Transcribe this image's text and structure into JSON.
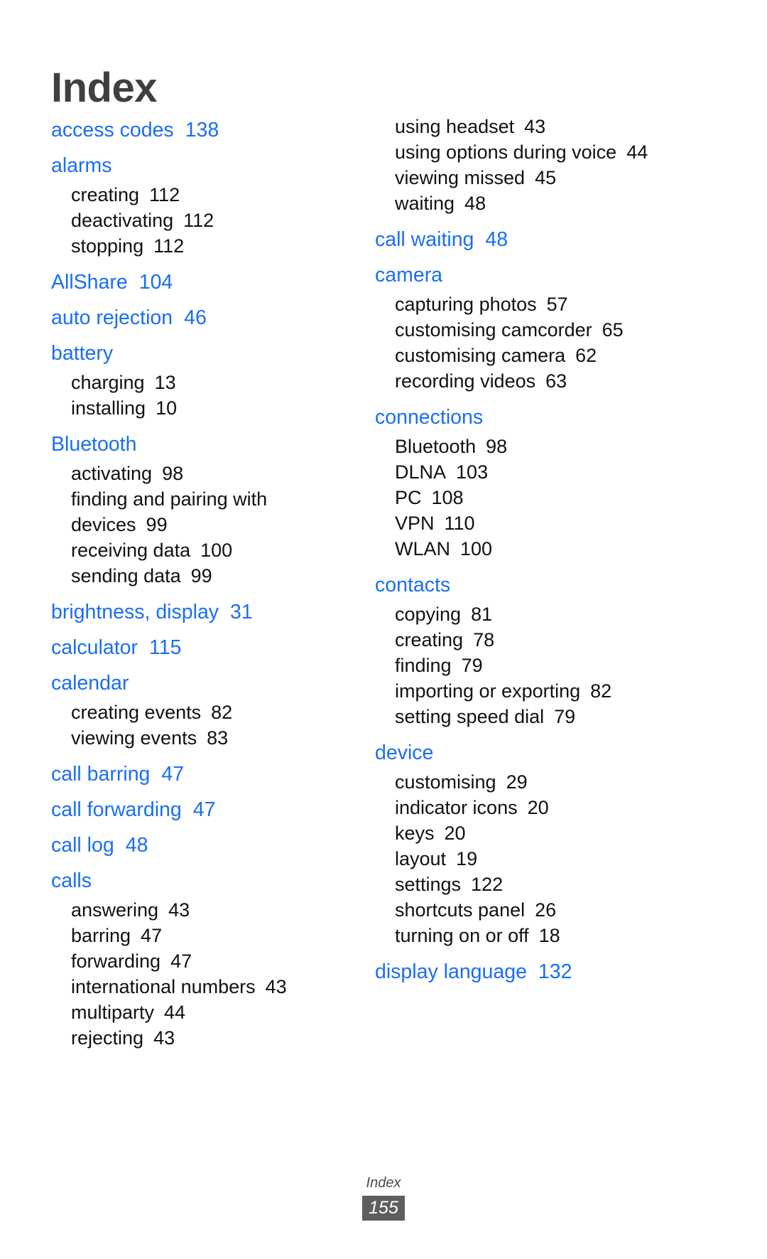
{
  "page": {
    "title": "Index",
    "footer_label": "Index",
    "footer_page_number": "155",
    "accent_color": "#1a6ef5",
    "title_color": "#3f3f3f",
    "body_color": "#111111",
    "footer_badge_bg": "#5e5e5e"
  },
  "columns": [
    {
      "id": "left",
      "entries": [
        {
          "heading": "access codes",
          "page": "138",
          "subs": []
        },
        {
          "heading": "alarms",
          "page": "",
          "subs": [
            {
              "label": "creating",
              "page": "112"
            },
            {
              "label": "deactivating",
              "page": "112"
            },
            {
              "label": "stopping",
              "page": "112"
            }
          ]
        },
        {
          "heading": "AllShare",
          "page": "104",
          "subs": []
        },
        {
          "heading": "auto rejection",
          "page": "46",
          "subs": []
        },
        {
          "heading": "battery",
          "page": "",
          "subs": [
            {
              "label": "charging",
              "page": "13"
            },
            {
              "label": "installing",
              "page": "10"
            }
          ]
        },
        {
          "heading": "Bluetooth",
          "page": "",
          "subs": [
            {
              "label": "activating",
              "page": "98"
            },
            {
              "label": "finding and pairing with devices",
              "page": "99"
            },
            {
              "label": "receiving data",
              "page": "100"
            },
            {
              "label": "sending data",
              "page": "99"
            }
          ]
        },
        {
          "heading": "brightness, display",
          "page": "31",
          "subs": []
        },
        {
          "heading": "calculator",
          "page": "115",
          "subs": []
        },
        {
          "heading": "calendar",
          "page": "",
          "subs": [
            {
              "label": "creating events",
              "page": "82"
            },
            {
              "label": "viewing events",
              "page": "83"
            }
          ]
        },
        {
          "heading": "call barring",
          "page": "47",
          "subs": []
        },
        {
          "heading": "call forwarding",
          "page": "47",
          "subs": []
        },
        {
          "heading": "call log",
          "page": "48",
          "subs": []
        },
        {
          "heading": "calls",
          "page": "",
          "subs": [
            {
              "label": "answering",
              "page": "43"
            },
            {
              "label": "barring",
              "page": "47"
            },
            {
              "label": "forwarding",
              "page": "47"
            },
            {
              "label": "international numbers",
              "page": "43"
            },
            {
              "label": "multiparty",
              "page": "44"
            },
            {
              "label": "rejecting",
              "page": "43"
            }
          ]
        }
      ]
    },
    {
      "id": "right",
      "entries": [
        {
          "heading": "",
          "page": "",
          "subs": [
            {
              "label": "using headset",
              "page": "43"
            },
            {
              "label": "using options during voice",
              "page": "44"
            },
            {
              "label": "viewing missed",
              "page": "45"
            },
            {
              "label": "waiting",
              "page": "48"
            }
          ]
        },
        {
          "heading": "call waiting",
          "page": "48",
          "subs": []
        },
        {
          "heading": "camera",
          "page": "",
          "subs": [
            {
              "label": "capturing photos",
              "page": "57"
            },
            {
              "label": "customising camcorder",
              "page": "65"
            },
            {
              "label": "customising camera",
              "page": "62"
            },
            {
              "label": "recording videos",
              "page": "63"
            }
          ]
        },
        {
          "heading": "connections",
          "page": "",
          "subs": [
            {
              "label": "Bluetooth",
              "page": "98"
            },
            {
              "label": "DLNA",
              "page": "103"
            },
            {
              "label": "PC",
              "page": "108"
            },
            {
              "label": "VPN",
              "page": "110"
            },
            {
              "label": "WLAN",
              "page": "100"
            }
          ]
        },
        {
          "heading": "contacts",
          "page": "",
          "subs": [
            {
              "label": "copying",
              "page": "81"
            },
            {
              "label": "creating",
              "page": "78"
            },
            {
              "label": "finding",
              "page": "79"
            },
            {
              "label": "importing or exporting",
              "page": "82"
            },
            {
              "label": "setting speed dial",
              "page": "79"
            }
          ]
        },
        {
          "heading": "device",
          "page": "",
          "subs": [
            {
              "label": "customising",
              "page": "29"
            },
            {
              "label": "indicator icons",
              "page": "20"
            },
            {
              "label": "keys",
              "page": "20"
            },
            {
              "label": "layout",
              "page": "19"
            },
            {
              "label": "settings",
              "page": "122"
            },
            {
              "label": "shortcuts panel",
              "page": "26"
            },
            {
              "label": "turning on or off",
              "page": "18"
            }
          ]
        },
        {
          "heading": "display language",
          "page": "132",
          "subs": []
        }
      ]
    }
  ]
}
